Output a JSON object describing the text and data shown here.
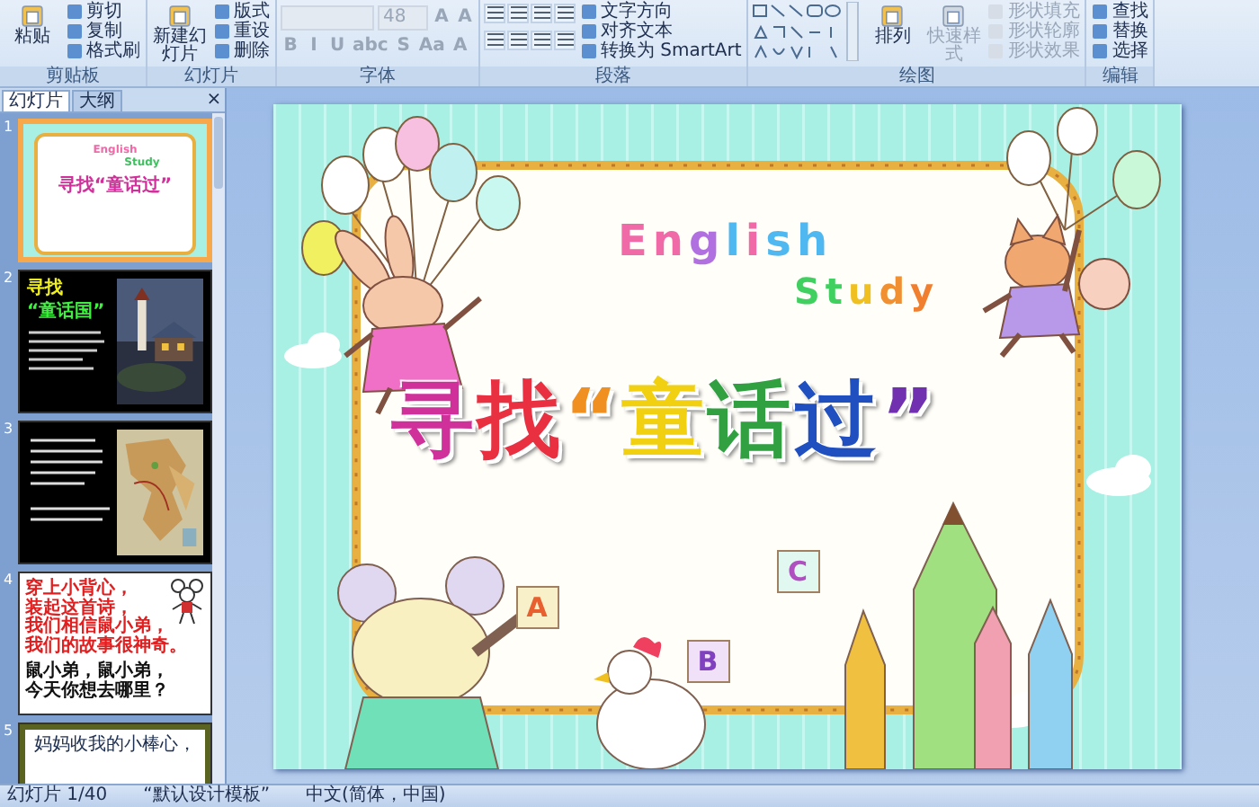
{
  "ribbon": {
    "groups": [
      {
        "label": "剪贴板",
        "columns": [
          [
            {
              "kind": "large",
              "label": "粘贴",
              "disabled": false
            }
          ],
          [
            {
              "kind": "small",
              "label": "剪切",
              "disabled": false
            },
            {
              "kind": "small",
              "label": "复制",
              "disabled": false
            },
            {
              "kind": "small",
              "label": "格式刷",
              "disabled": false
            }
          ]
        ]
      },
      {
        "label": "幻灯片",
        "columns": [
          [
            {
              "kind": "large",
              "label": "新建幻灯片",
              "disabled": false
            }
          ],
          [
            {
              "kind": "small",
              "label": "版式",
              "disabled": false
            },
            {
              "kind": "small",
              "label": "重设",
              "disabled": false
            },
            {
              "kind": "small",
              "label": "删除",
              "disabled": false
            }
          ]
        ]
      },
      {
        "label": "字体",
        "toolbars": [
          [
            {
              "kind": "field",
              "disabled": true
            },
            {
              "kind": "field",
              "label": "48",
              "disabled": true
            },
            {
              "kind": "glyph",
              "label": "A",
              "disabled": true
            },
            {
              "kind": "glyph",
              "label": "A",
              "disabled": true
            }
          ],
          [
            {
              "kind": "glyph",
              "label": "B",
              "disabled": true
            },
            {
              "kind": "glyph",
              "label": "I",
              "disabled": true
            },
            {
              "kind": "glyph",
              "label": "U",
              "disabled": true
            },
            {
              "kind": "glyph",
              "label": "abc",
              "disabled": true
            },
            {
              "kind": "glyph",
              "label": "S",
              "disabled": true
            },
            {
              "kind": "glyph",
              "label": "Aa",
              "disabled": true
            },
            {
              "kind": "glyph",
              "label": "A",
              "disabled": true
            }
          ]
        ]
      },
      {
        "label": "段落",
        "columns": [
          [
            {
              "kind": "icons",
              "disabled": false
            },
            {
              "kind": "icons",
              "disabled": false
            }
          ],
          [
            {
              "kind": "small",
              "label": "文字方向",
              "disabled": false
            },
            {
              "kind": "small",
              "label": "对齐文本",
              "disabled": false
            },
            {
              "kind": "small",
              "label": "转换为 SmartArt",
              "disabled": false
            }
          ]
        ]
      },
      {
        "label": "绘图",
        "columns": [
          [
            {
              "kind": "gallery",
              "disabled": false
            }
          ],
          [
            {
              "kind": "large",
              "label": "排列",
              "disabled": false
            }
          ],
          [
            {
              "kind": "large",
              "label": "快速样式",
              "disabled": true
            }
          ],
          [
            {
              "kind": "small",
              "label": "形状填充",
              "disabled": true
            },
            {
              "kind": "small",
              "label": "形状轮廓",
              "disabled": true
            },
            {
              "kind": "small",
              "label": "形状效果",
              "disabled": true
            }
          ]
        ]
      },
      {
        "label": "编辑",
        "columns": [
          [
            {
              "kind": "small",
              "label": "查找",
              "disabled": false
            },
            {
              "kind": "small",
              "label": "替换",
              "disabled": false
            },
            {
              "kind": "small",
              "label": "选择",
              "disabled": false
            }
          ]
        ]
      }
    ]
  },
  "panel": {
    "tabs": [
      {
        "label": "幻灯片",
        "selected": true
      },
      {
        "label": "大纲",
        "selected": false
      }
    ],
    "close": "×",
    "slides": [
      {
        "number": "1",
        "selected": true,
        "kind": "cover",
        "texts": [
          "English",
          "Study",
          "寻找“童话过”"
        ]
      },
      {
        "number": "2",
        "selected": false,
        "kind": "dark-picture",
        "texts": [
          "寻找",
          "“童话国”"
        ]
      },
      {
        "number": "3",
        "selected": false,
        "kind": "dark-map"
      },
      {
        "number": "4",
        "selected": false,
        "kind": "poem",
        "stanzas": [
          [
            "穿上小背心，",
            "装起这首诗，",
            "我们相信鼠小弟，",
            "我们的故事很神奇。"
          ],
          [
            "鼠小弟，鼠小弟，",
            "今天你想去哪里？"
          ]
        ]
      },
      {
        "number": "5",
        "selected": false,
        "kind": "framed",
        "texts": [
          "妈妈收我的小棒心，"
        ]
      }
    ]
  },
  "slide": {
    "english": [
      {
        "text": "E",
        "color": "#f06aa8"
      },
      {
        "text": "n",
        "color": "#f06aa8"
      },
      {
        "text": "g",
        "color": "#b070e0"
      },
      {
        "text": "l",
        "color": "#50b8f0"
      },
      {
        "text": "i",
        "color": "#f06aa8"
      },
      {
        "text": "s",
        "color": "#50b8f0"
      },
      {
        "text": "h",
        "color": "#50b8f0"
      }
    ],
    "study": [
      {
        "text": "S",
        "color": "#40d060"
      },
      {
        "text": "t",
        "color": "#40d060"
      },
      {
        "text": "u",
        "color": "#f0c020"
      },
      {
        "text": "d",
        "color": "#f09030"
      },
      {
        "text": "y",
        "color": "#f08030"
      }
    ],
    "title": [
      {
        "text": "寻",
        "color": "#d0309a"
      },
      {
        "text": "找",
        "color": "#e83040"
      },
      {
        "text": "“",
        "color": "#f09020"
      },
      {
        "text": "童",
        "color": "#f0d010"
      },
      {
        "text": "话",
        "color": "#30a040"
      },
      {
        "text": "过",
        "color": "#2050c0"
      },
      {
        "text": "”",
        "color": "#7030b0"
      }
    ],
    "blocks": [
      "A",
      "B",
      "C"
    ]
  },
  "status_bar": [
    "幻灯片 1/40",
    "“默认设计模板”",
    "中文(简体，中国)"
  ]
}
